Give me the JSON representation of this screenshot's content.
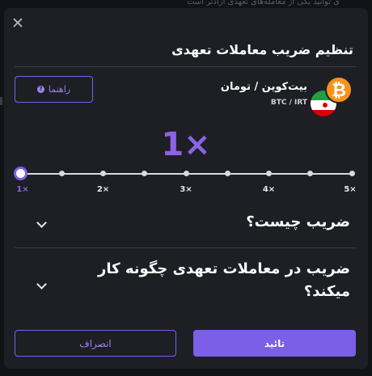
{
  "backdrop": {
    "text": "ی توانید یکی از معامله‌های تعهدی آزادتر است"
  },
  "modal": {
    "title": "تنظیم ضریب معاملات تعهدی",
    "close_icon": "close-icon",
    "help_button": {
      "label": "راهنما",
      "icon": "help-icon"
    },
    "pair": {
      "name": "بیت‌کوین / تومان",
      "code": "BTC / IRT",
      "coin_symbol": "₿"
    },
    "leverage": {
      "selected_label": "1×",
      "selected_value": 1,
      "min": 1,
      "max": 5,
      "ticks": [
        "1×",
        "2×",
        "3×",
        "4×",
        "5×"
      ]
    },
    "faq": [
      {
        "question": "ضریب چیست؟"
      },
      {
        "question_line1": "ضریب در معاملات تعهدی چگونه کار",
        "question_line2": "میکند؟"
      }
    ],
    "buttons": {
      "confirm": "تائید",
      "cancel": "انصراف"
    }
  },
  "colors": {
    "accent": "#7b5fe6",
    "accent_text": "#8a63e8",
    "modal_bg": "#1e1f25",
    "page_bg": "#121317",
    "btc": "#f7931a"
  }
}
